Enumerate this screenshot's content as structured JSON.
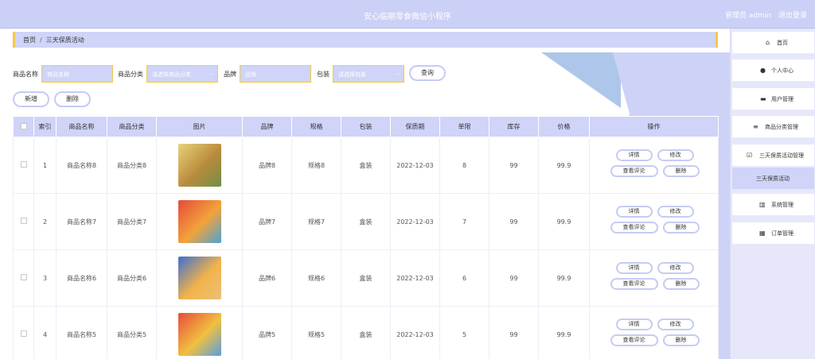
{
  "app": {
    "title": "安心临期零食微信小程序",
    "user_label": "管理员 admin",
    "logout_label": "退出登录"
  },
  "breadcrumb": {
    "home": "首页",
    "separator": "/",
    "current": "三天保质活动"
  },
  "search": {
    "name_label": "商品名称",
    "name_placeholder": "商品名称",
    "category_label": "商品分类",
    "category_placeholder": "请选择商品分类",
    "brand_label": "品牌",
    "brand_placeholder": "品牌",
    "package_label": "包装",
    "package_placeholder": "请选择包装",
    "query_label": "查询"
  },
  "actions": {
    "add_label": "新增",
    "delete_label": "删除"
  },
  "table": {
    "headers": [
      "索引",
      "商品名称",
      "商品分类",
      "图片",
      "品牌",
      "规格",
      "包装",
      "保质期",
      "单限",
      "库存",
      "价格",
      "操作"
    ],
    "rows": [
      {
        "index": "1",
        "name": "商品名称8",
        "category": "商品分类8",
        "brand": "品牌8",
        "spec": "规格8",
        "package": "盒装",
        "expiry": "2022-12-03",
        "limit": "8",
        "stock": "99",
        "price": "99.9"
      },
      {
        "index": "2",
        "name": "商品名称7",
        "category": "商品分类7",
        "brand": "品牌7",
        "spec": "规格7",
        "package": "盒装",
        "expiry": "2022-12-03",
        "limit": "7",
        "stock": "99",
        "price": "99.9"
      },
      {
        "index": "3",
        "name": "商品名称6",
        "category": "商品分类6",
        "brand": "品牌6",
        "spec": "规格6",
        "package": "盒装",
        "expiry": "2022-12-03",
        "limit": "6",
        "stock": "99",
        "price": "99.9"
      },
      {
        "index": "4",
        "name": "商品名称5",
        "category": "商品分类5",
        "brand": "品牌5",
        "spec": "规格5",
        "package": "盒装",
        "expiry": "2022-12-03",
        "limit": "5",
        "stock": "99",
        "price": "99.9"
      }
    ],
    "op_labels": {
      "detail": "详情",
      "edit": "修改",
      "comments": "查看评论",
      "delete": "删除"
    }
  },
  "sidebar": {
    "items": [
      {
        "label": "首页",
        "icon": "home-icon"
      },
      {
        "label": "个人中心",
        "icon": "user-icon"
      },
      {
        "label": "用户管理",
        "icon": "chat-icon"
      },
      {
        "label": "商品分类管理",
        "icon": "list-icon"
      },
      {
        "label": "三天保质活动管理",
        "icon": "checkbox-icon"
      },
      {
        "label": "三天保质活动",
        "icon": ""
      },
      {
        "label": "系统管理",
        "icon": "bar-chart-icon"
      },
      {
        "label": "订单管理",
        "icon": "grid-icon"
      }
    ]
  },
  "colors": {
    "accent": "#cfd4f8",
    "border_accent": "#f2c94c",
    "button_border": "#c6cbf4",
    "decoration": "#aec6ea"
  }
}
